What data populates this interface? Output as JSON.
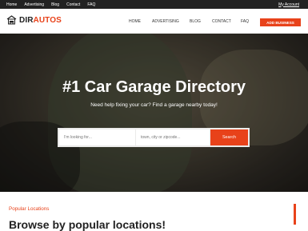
{
  "topbar": {
    "links": [
      "Home",
      "Advertising",
      "Blog",
      "Contact",
      "FAQ"
    ],
    "account": "My Account"
  },
  "header": {
    "logo_part1": "DIR",
    "logo_part2": "AUTOS",
    "logo_icon": "car-garage-icon",
    "nav": [
      "HOME",
      "ADVERTISING",
      "BLOG",
      "CONTACT",
      "FAQ"
    ],
    "add_business": "ADD BUSINESS"
  },
  "hero": {
    "title": "#1 Car Garage Directory",
    "subtitle": "Need help fixing your car? Find a garage nearby today!"
  },
  "search": {
    "query_placeholder": "I'm looking for...",
    "location_placeholder": "town, city or zipcode...",
    "button": "Search"
  },
  "popular": {
    "label": "Popular Locations",
    "title": "Browse by popular locations!"
  },
  "colors": {
    "accent": "#e8421a",
    "topbar": "#222222"
  }
}
